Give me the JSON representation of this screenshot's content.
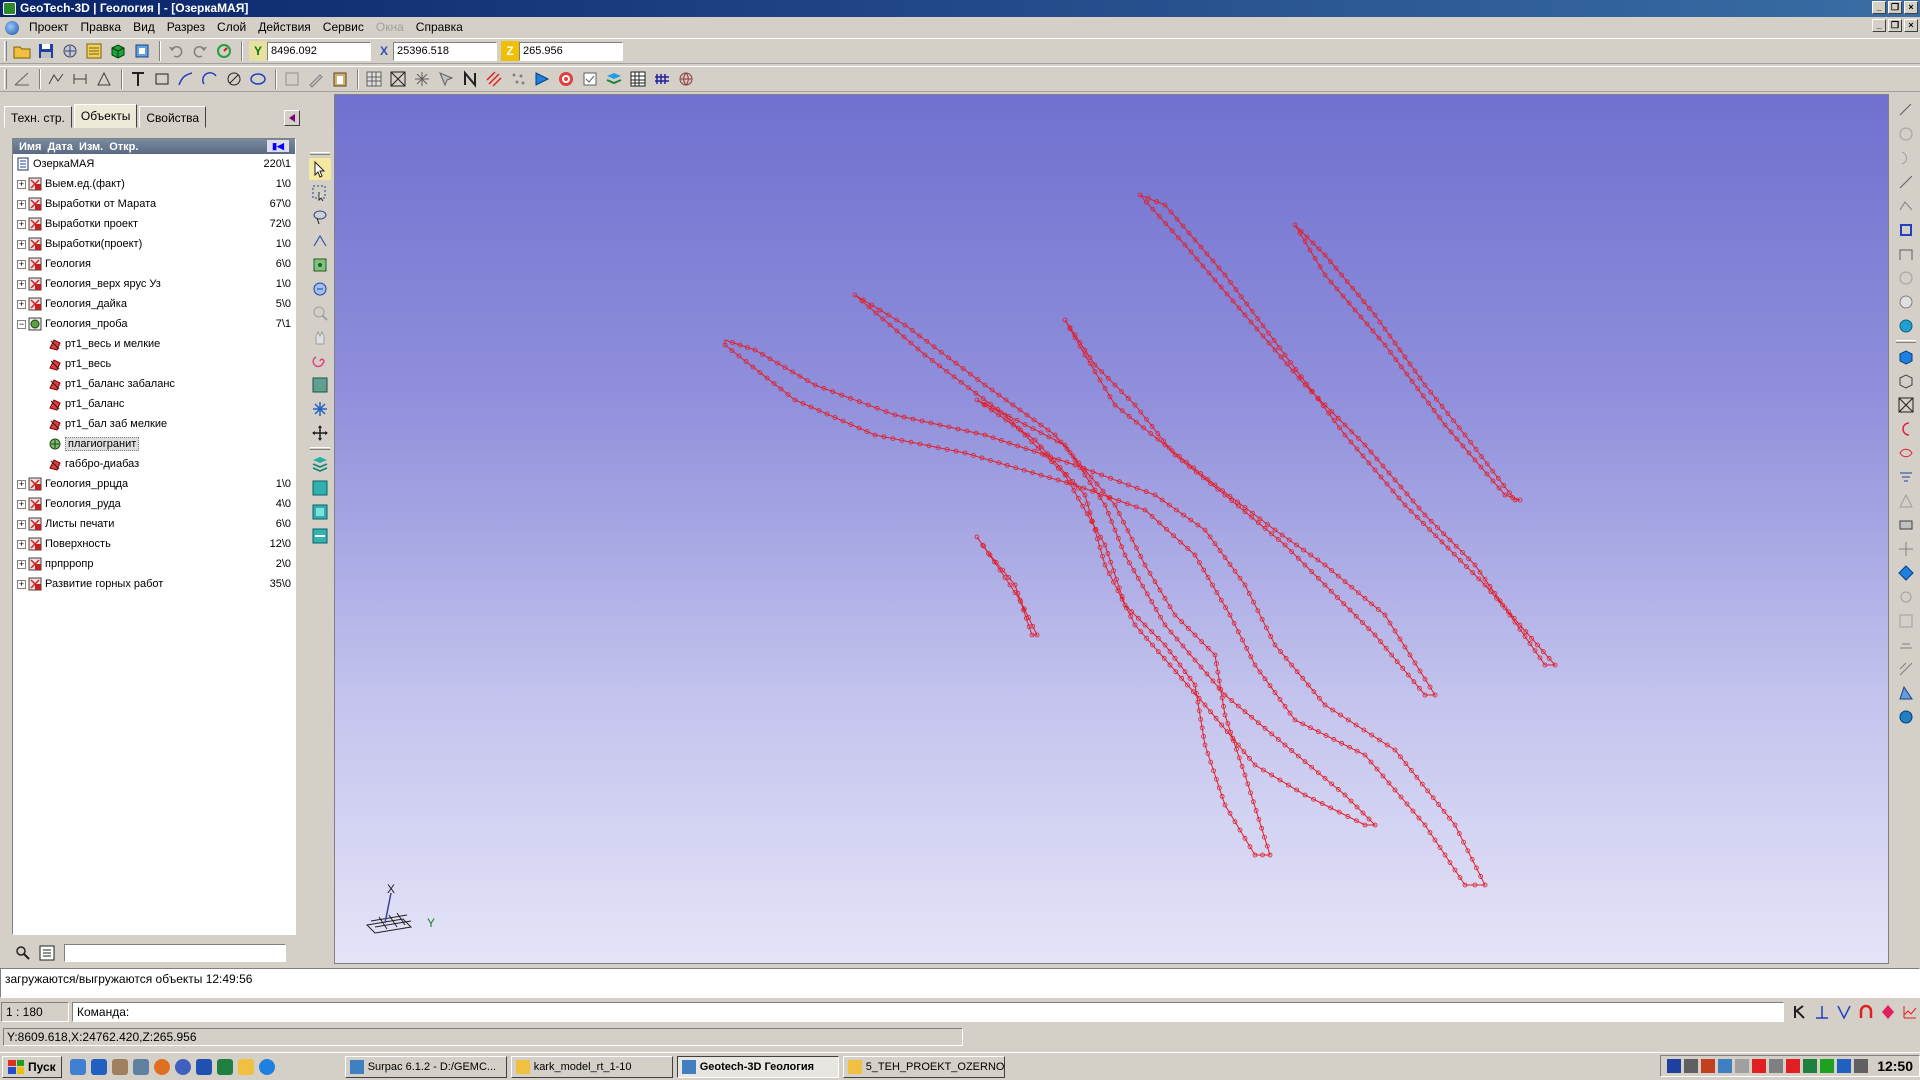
{
  "window": {
    "title": "GeoTech-3D | Геология | - [ОзеркаМАЯ]"
  },
  "menu": [
    "Проект",
    "Правка",
    "Вид",
    "Разрез",
    "Слой",
    "Действия",
    "Сервис",
    "Окна",
    "Справка"
  ],
  "coords": {
    "y_label": "Y",
    "y_value": "8496.092",
    "x_label": "X",
    "x_value": "25396.518",
    "z_label": "Z",
    "z_value": "265.956"
  },
  "panel": {
    "tabs": [
      "Техн. стр.",
      "Объекты",
      "Свойства"
    ],
    "active_tab": "Объекты",
    "columns": [
      "Имя",
      "Дата",
      "Изм.",
      "Откр."
    ],
    "tree": [
      {
        "label": "ОзеркаМАЯ",
        "count": "220\\1",
        "level": 0,
        "expander": "",
        "icon": "document-icon"
      },
      {
        "label": "Выем.ед.(факт)",
        "count": "1\\0",
        "level": 1,
        "expander": "+",
        "icon": "layer-red-icon"
      },
      {
        "label": "Выработки от Марата",
        "count": "67\\0",
        "level": 1,
        "expander": "+",
        "icon": "layer-red-icon"
      },
      {
        "label": "Выработки проект",
        "count": "72\\0",
        "level": 1,
        "expander": "+",
        "icon": "layer-red-icon"
      },
      {
        "label": "Выработки(проект)",
        "count": "1\\0",
        "level": 1,
        "expander": "+",
        "icon": "layer-red-icon"
      },
      {
        "label": "Геология",
        "count": "6\\0",
        "level": 1,
        "expander": "+",
        "icon": "layer-red-icon"
      },
      {
        "label": "Геология_верх ярус Уз",
        "count": "1\\0",
        "level": 1,
        "expander": "+",
        "icon": "layer-red-icon"
      },
      {
        "label": "Геология_дайка",
        "count": "5\\0",
        "level": 1,
        "expander": "+",
        "icon": "layer-red-icon"
      },
      {
        "label": "Геология_проба",
        "count": "7\\1",
        "level": 1,
        "expander": "−",
        "icon": "layer-open-icon"
      },
      {
        "label": "рт1_весь и мелкие",
        "count": "",
        "level": 2,
        "expander": "",
        "icon": "object-red-icon"
      },
      {
        "label": "рт1_весь",
        "count": "",
        "level": 2,
        "expander": "",
        "icon": "object-red-icon"
      },
      {
        "label": "рт1_баланс забаланс",
        "count": "",
        "level": 2,
        "expander": "",
        "icon": "object-red-icon"
      },
      {
        "label": "рт1_баланс",
        "count": "",
        "level": 2,
        "expander": "",
        "icon": "object-red-icon"
      },
      {
        "label": "рт1_бал заб мелкие",
        "count": "",
        "level": 2,
        "expander": "",
        "icon": "object-red-icon"
      },
      {
        "label": "плагиогранит",
        "count": "",
        "level": 2,
        "expander": "",
        "icon": "object-green-icon",
        "selected": true
      },
      {
        "label": "габбро-диабаз",
        "count": "",
        "level": 2,
        "expander": "",
        "icon": "object-red-icon"
      },
      {
        "label": "Геология_ррцда",
        "count": "1\\0",
        "level": 1,
        "expander": "+",
        "icon": "layer-red-icon"
      },
      {
        "label": "Геология_руда",
        "count": "4\\0",
        "level": 1,
        "expander": "+",
        "icon": "layer-red-icon"
      },
      {
        "label": "Листы печати",
        "count": "6\\0",
        "level": 1,
        "expander": "+",
        "icon": "layer-red-icon"
      },
      {
        "label": "Поверхность",
        "count": "12\\0",
        "level": 1,
        "expander": "+",
        "icon": "layer-red-icon"
      },
      {
        "label": "прпрропр",
        "count": "2\\0",
        "level": 1,
        "expander": "+",
        "icon": "layer-red-icon"
      },
      {
        "label": "Развитие горных работ",
        "count": "35\\0",
        "level": 1,
        "expander": "+",
        "icon": "layer-red-icon"
      }
    ]
  },
  "viewport": {
    "axis_x_label": "X",
    "axis_y_label": "Y",
    "outline_color": "#e0202a"
  },
  "status": {
    "message": "загружаются/выгружаются объекты 12:49:56",
    "scale": "1 : 180",
    "command_label": "Команда:",
    "cursor_coords": "Y:8609.618,X:24762.420,Z:265.956"
  },
  "taskbar": {
    "start": "Пуск",
    "tasks": [
      {
        "label": "Surpac 6.1.2 - D:/GEMC...",
        "active": false
      },
      {
        "label": "kark_model_rt_1-10",
        "active": false
      },
      {
        "label": "Geotech-3D Геология",
        "active": true
      },
      {
        "label": "5_TEH_PROEKT_OZERNOE",
        "active": false
      }
    ],
    "clock": "12:50"
  },
  "colors": {
    "title_bar": "#0a246a",
    "viewport_top": "#7070d0",
    "viewport_bottom": "#e4e4f8",
    "outline": "#e0202a"
  }
}
